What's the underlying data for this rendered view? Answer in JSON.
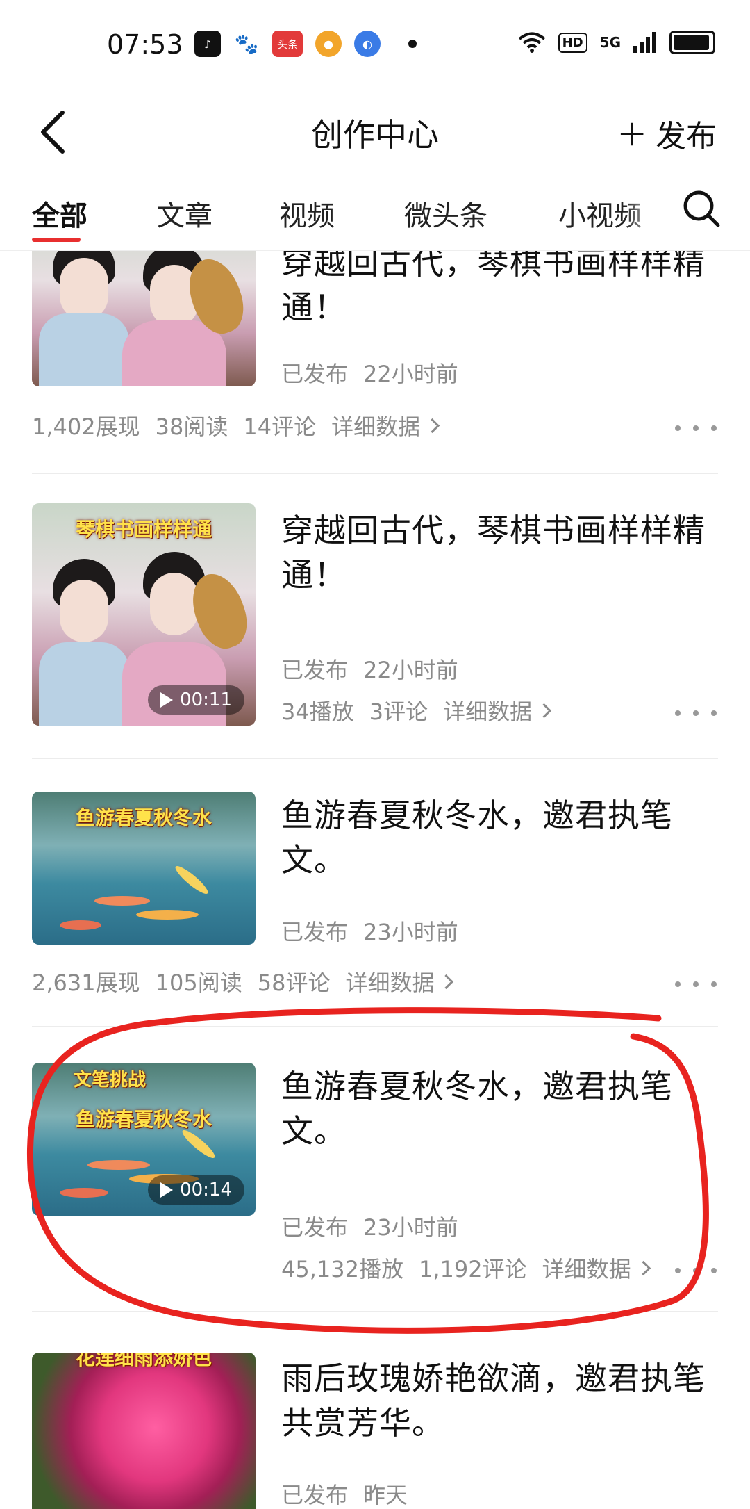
{
  "status_bar": {
    "time": "07:53",
    "app_icons": [
      "tiktok-icon",
      "baidu-icon",
      "toutiao-icon",
      "app-icon",
      "app-icon"
    ],
    "toutiao_label": "头条",
    "hd": "HD",
    "network": "5G"
  },
  "nav": {
    "title": "创作中心",
    "publish_label": "发布"
  },
  "tabs": [
    {
      "label": "全部"
    },
    {
      "label": "文章"
    },
    {
      "label": "视频"
    },
    {
      "label": "微头条"
    },
    {
      "label": "小视频"
    }
  ],
  "items": [
    {
      "title": "穿越回古代，琴棋书画样样精通！",
      "status": "已发布",
      "time": "22小时前",
      "stats": [
        "1,402展现",
        "38阅读",
        "14评论"
      ],
      "detail": "详细数据"
    },
    {
      "title": "穿越回古代，琴棋书画样样精通！",
      "banner": "琴棋书画样样通",
      "duration": "00:11",
      "status": "已发布",
      "time": "22小时前",
      "stats": [
        "34播放",
        "3评论"
      ],
      "detail": "详细数据"
    },
    {
      "title": "鱼游春夏秋冬水，邀君执笔文。",
      "banner": "鱼游春夏秋冬水",
      "status": "已发布",
      "time": "23小时前",
      "stats": [
        "2,631展现",
        "105阅读",
        "58评论"
      ],
      "detail": "详细数据"
    },
    {
      "title": "鱼游春夏秋冬水，邀君执笔文。",
      "tag": "文笔挑战",
      "banner": "鱼游春夏秋冬水",
      "duration": "00:14",
      "status": "已发布",
      "time": "23小时前",
      "stats": [
        "45,132播放",
        "1,192评论"
      ],
      "detail": "详细数据"
    },
    {
      "title": "雨后玫瑰娇艳欲滴，邀君执笔共赏芳华。",
      "banner": "花莲细雨添娇色",
      "status": "已发布",
      "time": "昨天"
    }
  ],
  "colors": {
    "accent": "#e82f2f",
    "muted_text": "#8a8a8a",
    "highlight_circle": "#e8231f"
  }
}
